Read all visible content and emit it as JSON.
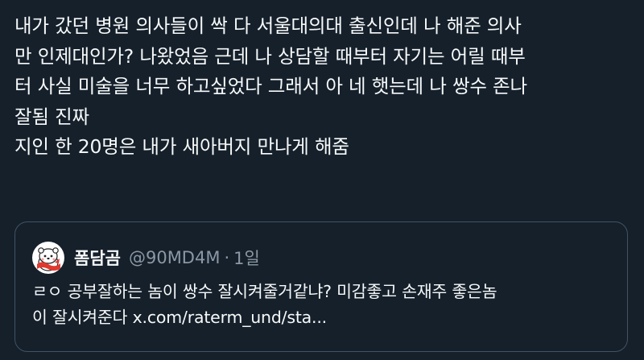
{
  "tweet": {
    "lines": [
      "내가 갔던 병원 의사들이 싹 다 서울대의대 출신인데 나 해준 의사",
      "만 인제대인가? 나왔었음 근데 나 상담할 때부터 자기는 어릴 때부",
      "터 사실 미술을 너무 하고싶었다 그래서 아 네 햇는데 나 쌍수 존나",
      "잘됨 진짜",
      "지인 한 20명은 내가 새아버지 만나게 해줌"
    ]
  },
  "quote": {
    "author_name": "폼담곰",
    "author_handle": "@90MD4M",
    "separator": "·",
    "age": "1일",
    "lines": [
      "ㄹㅇ 공부잘하는 놈이 쌍수 잘시켜줄거같냐? 미감좋고 손재주 좋은놈",
      "이 잘시켜준다 x.com/raterm_und/sta..."
    ]
  },
  "colors": {
    "background": "#15202b",
    "text": "#f7f9f9",
    "muted": "#8b98a5",
    "border": "#425364"
  },
  "icons": {
    "avatar": "bear-mascot-avatar"
  }
}
